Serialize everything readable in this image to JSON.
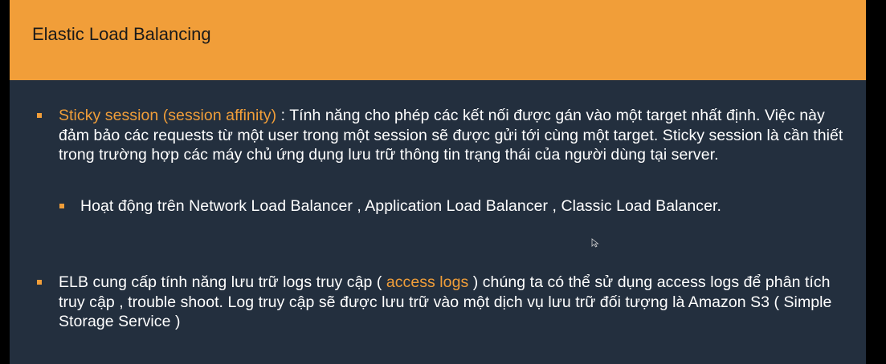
{
  "slide": {
    "title": "Elastic Load Balancing",
    "accent_color": "#f19e39",
    "background_color": "#232f3e",
    "bullets": [
      {
        "highlight": "Sticky session (session affinity)",
        "text": " : Tính năng cho phép các kết nối được gán vào một target nhất định. Việc này đảm bảo các requests từ một user trong một session sẽ được gửi tới cùng một target. Sticky session là cần thiết trong trường hợp các máy chủ ứng dụng lưu trữ thông tin trạng thái của người dùng tại server.",
        "sub_bullets": [
          {
            "text": "Hoạt động trên Network Load Balancer , Application Load Balancer , Classic Load Balancer."
          }
        ]
      },
      {
        "text_before": "ELB cung cấp tính năng lưu trữ logs truy cập ( ",
        "highlight": "access logs",
        "text_after": " ) chúng ta có thể sử dụng access logs để phân tích truy cập , trouble shoot. Log truy cập sẽ được lưu trữ vào một dịch vụ lưu trữ đối tượng là Amazon S3 ( Simple Storage Service )"
      }
    ]
  },
  "cursor_icon": "arrow-cursor-icon"
}
